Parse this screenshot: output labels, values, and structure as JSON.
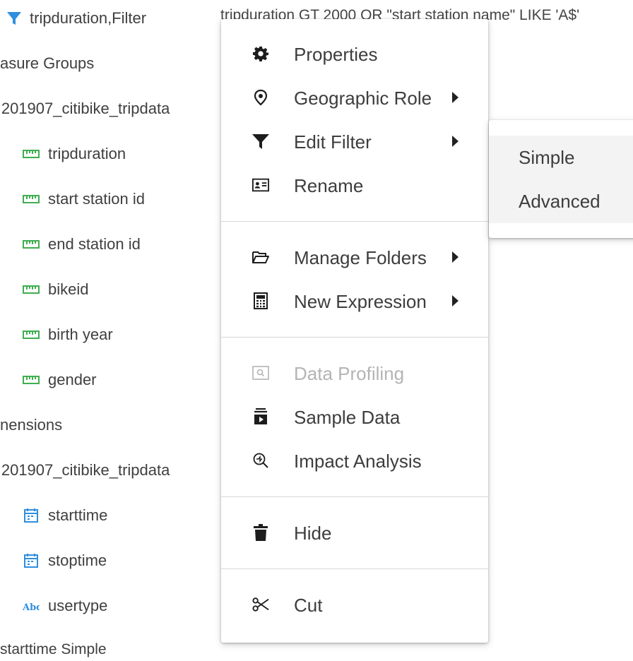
{
  "tree": {
    "filter_row": {
      "label": "tripduration,Filter",
      "expression": "tripduration GT 2000 OR \"start station name\" LIKE 'A$'"
    },
    "measure_groups_label": "asure Groups",
    "measure_table": " 201907_citibike_tripdata",
    "measures": [
      "tripduration",
      "start station id",
      "end station id",
      "bikeid",
      "birth year",
      "gender"
    ],
    "dimensions_label": "nensions",
    "dimension_table": " 201907_citibike_tripdata",
    "dimension_items": [
      {
        "label": "starttime",
        "icon": "calendar-icon"
      },
      {
        "label": "stoptime",
        "icon": "calendar-icon"
      },
      {
        "label": "usertype",
        "icon": "text-type-icon"
      }
    ],
    "partial_bottom": "starttime Simple"
  },
  "context_menu": {
    "items": [
      {
        "label": "Properties",
        "icon": "gear-icon"
      },
      {
        "label": "Geographic Role",
        "icon": "map-pin-icon",
        "submenu": true
      },
      {
        "label": "Edit Filter",
        "icon": "filter-icon",
        "submenu": true
      },
      {
        "label": "Rename",
        "icon": "id-card-icon"
      },
      {
        "label": "Manage Folders",
        "icon": "folder-open-icon",
        "submenu": true
      },
      {
        "label": "New Expression",
        "icon": "calculator-icon",
        "submenu": true
      },
      {
        "label": "Data Profiling",
        "icon": "profiling-icon",
        "disabled": true
      },
      {
        "label": "Sample Data",
        "icon": "sample-data-icon"
      },
      {
        "label": "Impact Analysis",
        "icon": "zoom-analysis-icon"
      },
      {
        "label": "Hide",
        "icon": "trash-icon"
      },
      {
        "label": "Cut",
        "icon": "scissors-icon"
      }
    ]
  },
  "edit_filter_submenu": {
    "items": [
      "Simple",
      "Advanced"
    ]
  },
  "colors": {
    "filter_blue": "#2f8ee0",
    "measure_green": "#3fae4f",
    "text_dark": "#3d3d3d",
    "disabled": "#b4b4b4"
  }
}
